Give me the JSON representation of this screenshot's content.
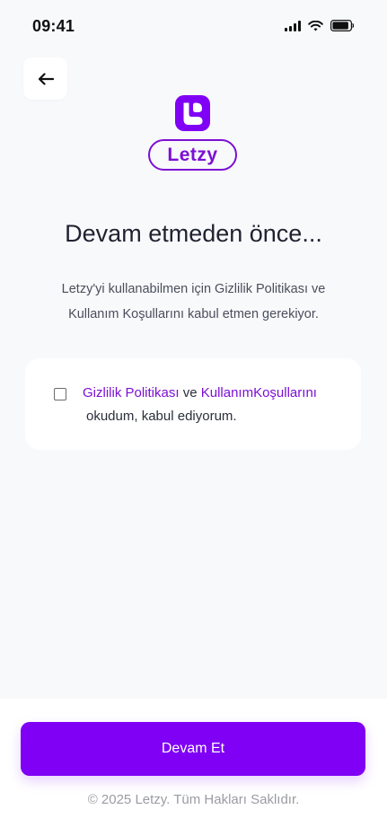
{
  "status_bar": {
    "time": "09:41",
    "icons": [
      "signal-icon",
      "wifi-icon",
      "battery-icon"
    ]
  },
  "header": {
    "back_icon": "arrow-left-icon"
  },
  "brand": {
    "name": "Letzy",
    "color": "#7c0fd4"
  },
  "main": {
    "title": "Devam etmeden önce...",
    "description_line1": "Letzy'yi kullanabilmen için Gizlilik Politikası ve",
    "description_line2": "Kullanım Koşullarını kabul etmen gerekiyor."
  },
  "consent": {
    "checked": false,
    "privacy_link": "Gizlilik Politikası",
    "conjunction": "ve",
    "terms_link": "KullanımKoşullarını",
    "suffix": "okudum, kabul ediyorum."
  },
  "footer": {
    "continue_label": "Devam Et",
    "copyright": "© 2025 Letzy. Tüm Hakları Saklıdır.",
    "button_color": "#7f00f5"
  }
}
